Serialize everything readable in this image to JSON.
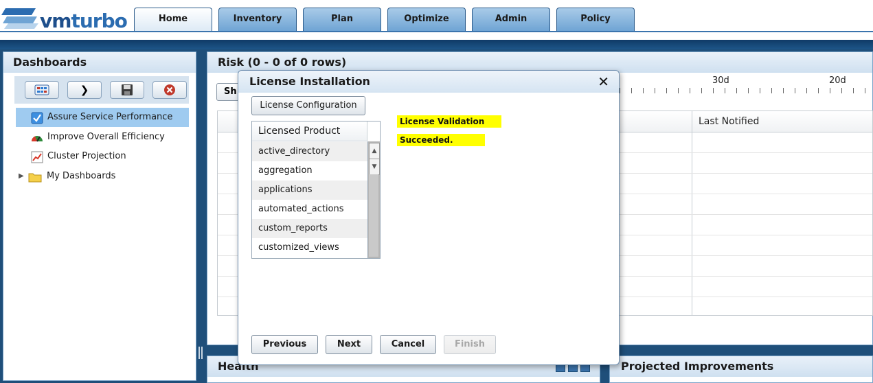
{
  "brand": {
    "logo_text_vm": "vm",
    "logo_text_turbo": "turbo"
  },
  "tabs": [
    "Home",
    "Inventory",
    "Plan",
    "Optimize",
    "Admin",
    "Policy"
  ],
  "active_tab": "Home",
  "dashboards": {
    "title": "Dashboards",
    "toolbar": [
      "new-dashboard-icon",
      "share-icon",
      "save-icon",
      "delete-icon"
    ],
    "items": [
      {
        "label": "Assure Service Performance",
        "icon": "checkbox-icon",
        "selected": true
      },
      {
        "label": "Improve Overall Efficiency",
        "icon": "gauge-icon"
      },
      {
        "label": "Cluster Projection",
        "icon": "chart-icon"
      },
      {
        "label": "My Dashboards",
        "icon": "folder-icon"
      }
    ]
  },
  "risk": {
    "title": "Risk (0 - 0 of 0 rows)",
    "show_button_partial": "Sh",
    "timeline_labels": [
      "30d",
      "20d"
    ],
    "column_last_notified": "Last Notified"
  },
  "health": {
    "title": "Health"
  },
  "projected": {
    "title": "Projected Improvements"
  },
  "dialog": {
    "title": "License Installation",
    "close": "✕",
    "config_button": "License Configuration",
    "list_header": "Licensed Product",
    "products": [
      "active_directory",
      "aggregation",
      "applications",
      "automated_actions",
      "custom_reports",
      "customized_views"
    ],
    "status_line1": "License Validation",
    "status_line2": "Succeeded.",
    "buttons": {
      "previous": "Previous",
      "next": "Next",
      "cancel": "Cancel",
      "finish": "Finish"
    }
  },
  "colors": {
    "accent": "#1f4f7a",
    "highlight": "#ffff00",
    "selection": "#9fcbf0"
  }
}
